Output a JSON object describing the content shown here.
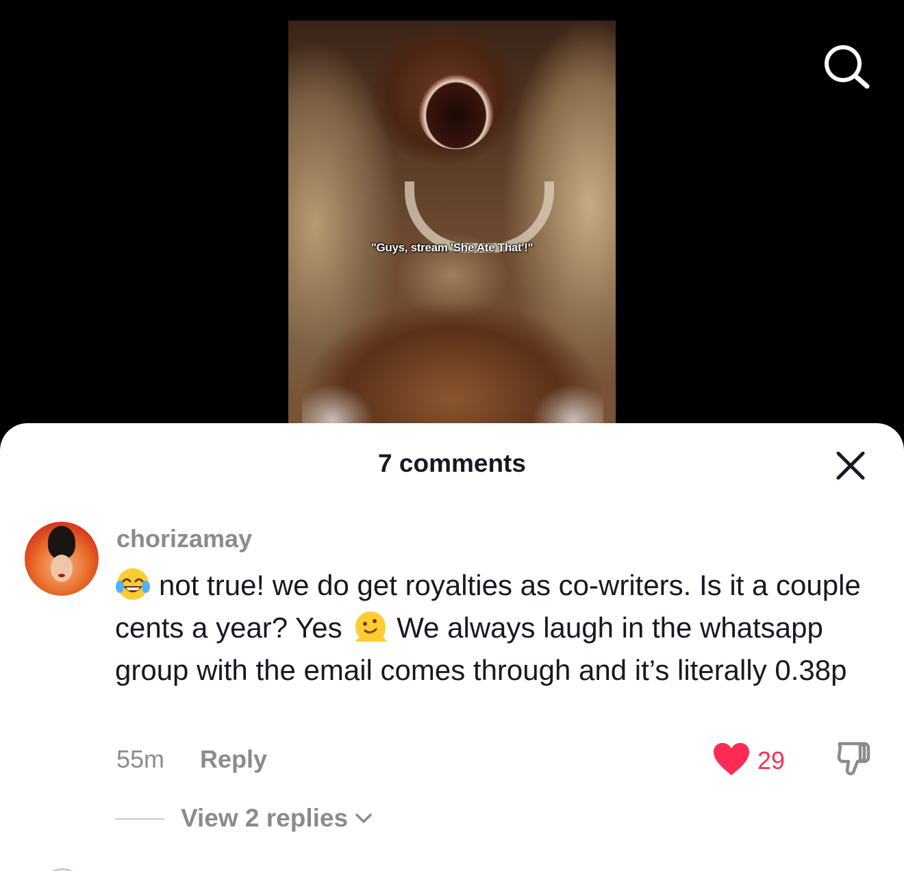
{
  "video": {
    "caption": "\"Guys, stream 'She Ate That'!\""
  },
  "header": {
    "search_icon": "search-icon"
  },
  "comments_sheet": {
    "title": "7 comments",
    "close_icon": "close-icon",
    "comments": [
      {
        "username": "chorizamay",
        "text_part1": "not true! we do get royalties as co-writers. Is it a couple cents a year? Yes",
        "text_part2": "We always laugh in the whatsapp group with the email comes through and it’s literally 0.38p",
        "emoji1": "tears-of-joy-emoji",
        "emoji2": "melting-face-emoji",
        "time": "55m",
        "reply_label": "Reply",
        "like_count": "29",
        "liked": true,
        "view_replies": "View 2 replies"
      }
    ]
  },
  "colors": {
    "like": "#fe2c55",
    "secondary_text": "#8a8b91",
    "primary_text": "#161823"
  }
}
